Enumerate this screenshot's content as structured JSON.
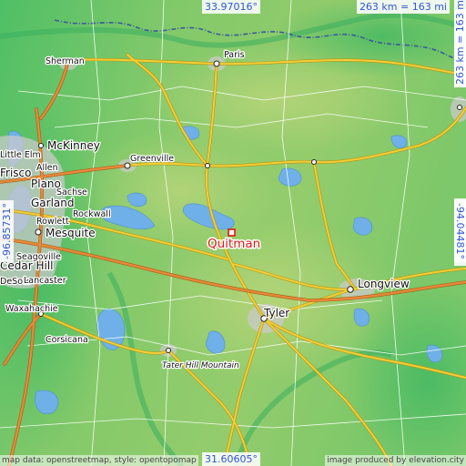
{
  "map": {
    "highlight_city": "Quitman",
    "colors": {
      "terrain_low": "#62c86a",
      "terrain_high": "#a8cf72",
      "water": "#6fb0e8",
      "highway": "#e8c02a",
      "highway_edge": "#b8920f",
      "interstate": "#e0852a",
      "road_minor": "#ffffff",
      "urban": "#c9c9c9",
      "border": "#3a5a9a",
      "highlight": "#e01818",
      "coord_text": "#2f55d8"
    }
  },
  "coordinates": {
    "top": "33.97016°",
    "bottom": "31.60605°",
    "left": "-96.85731°",
    "right": "-94.04481°"
  },
  "scale": {
    "top": "263 km = 163 mi",
    "side": "263 km = 163 mi"
  },
  "attribution": {
    "left": "map data: openstreetmap, style: opentopomap",
    "right": "image produced by elevation.city"
  },
  "labels": {
    "sherman": "Sherman",
    "paris": "Paris",
    "little_elm": "Little Elm",
    "mckinney": "McKinney",
    "allen": "Allen",
    "frisco": "Frisco",
    "plano": "Plano",
    "sachse": "Sachse",
    "garland": "Garland",
    "rockwall": "Rockwall",
    "rowlett": "Rowlett",
    "mesquite": "Mesquite",
    "seagoville": "Seagoville",
    "cedar_hill": "Cedar Hill",
    "desoto": "DeSoto",
    "lancaster": "Lancaster",
    "waxahachie": "Waxahachie",
    "greenville": "Greenville",
    "quitman": "Quitman",
    "longview": "Longview",
    "tyler": "Tyler",
    "corsicana": "Corsicana",
    "tater_hill": "Tater Hill Mountain"
  }
}
